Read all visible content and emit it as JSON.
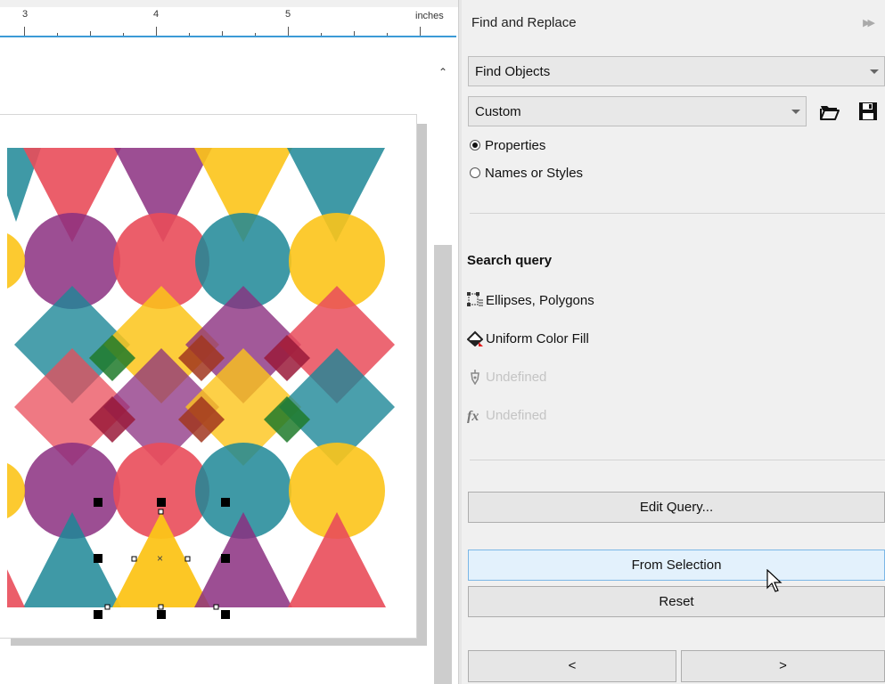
{
  "ruler": {
    "labels": [
      "3",
      "4",
      "5"
    ],
    "unit": "inches"
  },
  "docker": {
    "title": "Find and Replace",
    "mode_select": "Find Objects",
    "preset_select": "Custom",
    "radio_properties": "Properties",
    "radio_names": "Names or Styles",
    "search_query_title": "Search query",
    "query_rows": [
      {
        "label": "Ellipses, Polygons",
        "icon": "object-type-icon",
        "enabled": true
      },
      {
        "label": "Uniform Color Fill",
        "icon": "fill-bucket-icon",
        "enabled": true
      },
      {
        "label": "Undefined",
        "icon": "pen-nib-icon",
        "enabled": false
      },
      {
        "label": "Undefined",
        "icon": "fx-icon",
        "enabled": false
      }
    ],
    "edit_query_button": "Edit Query...",
    "from_selection_button": "From Selection",
    "reset_button": "Reset",
    "prev_button": "<",
    "next_button": ">"
  },
  "colors": {
    "red": "#e94c5a",
    "purple": "#8b2f80",
    "yellow": "#fcc419",
    "teal": "#1d8797",
    "accent": "#3c9ad6"
  }
}
